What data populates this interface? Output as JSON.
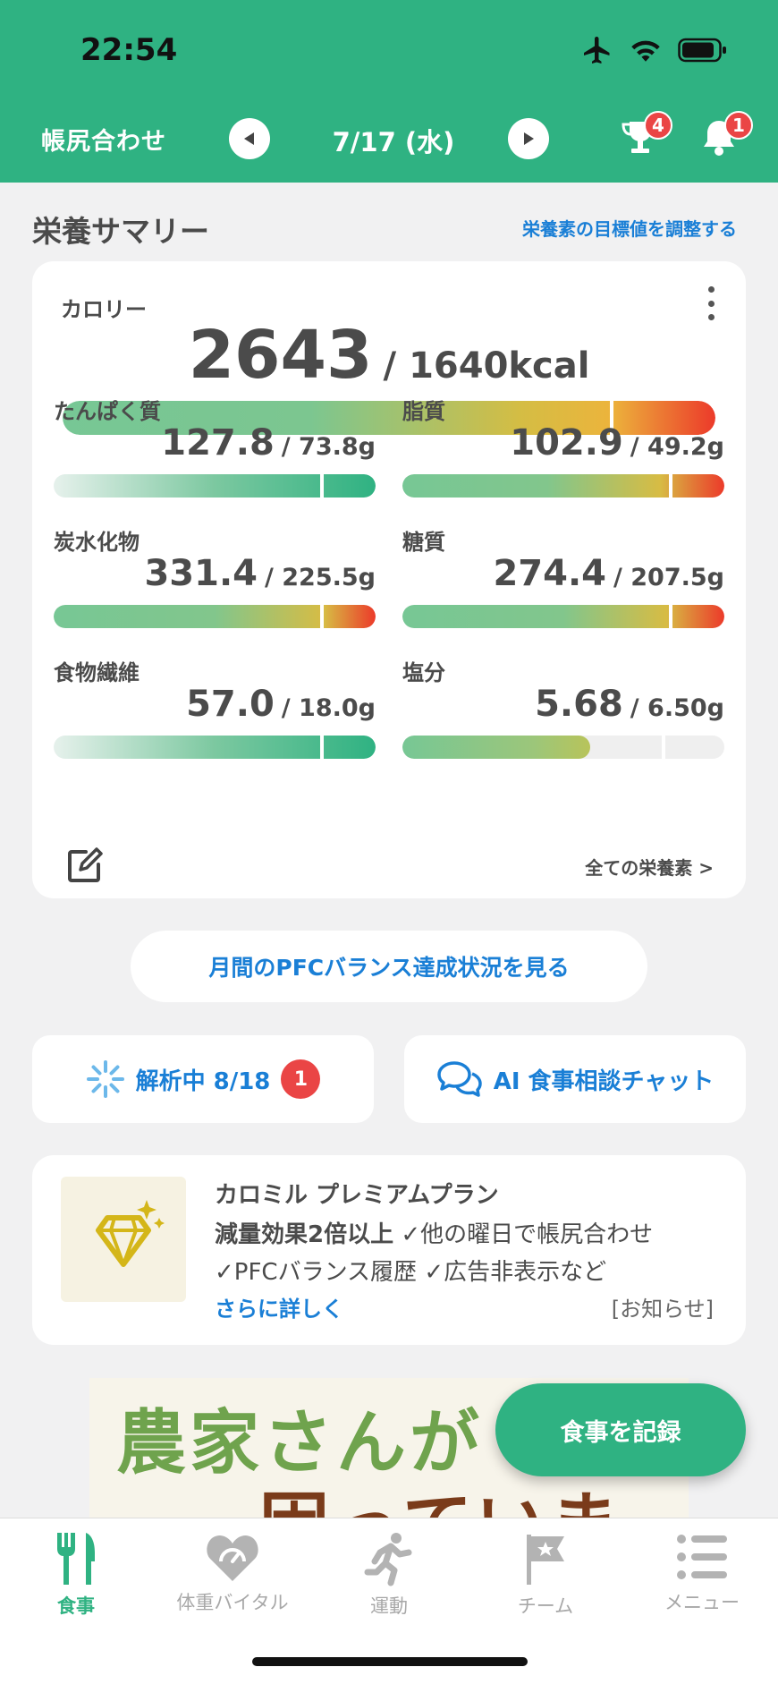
{
  "status_bar": {
    "time": "22:54"
  },
  "header": {
    "title": "帳尻合わせ",
    "date": "7/17 (水)",
    "trophy_badge": "4",
    "bell_badge": "1",
    "background": "#2fb282"
  },
  "summary": {
    "title": "栄養サマリー",
    "adjust_link": "栄養素の目標値を調整する",
    "calorie": {
      "label": "カロリー",
      "value": "2643",
      "target": "/ 1640kcal",
      "progress": 1.61
    },
    "nutrients": [
      {
        "label": "たんぱく質",
        "value": "127.8",
        "target": "/ 73.8g",
        "status": "over-good"
      },
      {
        "label": "脂質",
        "value": "102.9",
        "target": "/ 49.2g",
        "status": "over"
      },
      {
        "label": "炭水化物",
        "value": "331.4",
        "target": "/ 225.5g",
        "status": "over"
      },
      {
        "label": "糖質",
        "value": "274.4",
        "target": "/ 207.5g",
        "status": "over"
      },
      {
        "label": "食物繊維",
        "value": "57.0",
        "target": "/ 18.0g",
        "status": "over-good"
      },
      {
        "label": "塩分",
        "value": "5.68",
        "target": "/ 6.50g",
        "status": "under",
        "progress": 0.87
      }
    ],
    "all_nutrients_link": "全ての栄養素 >"
  },
  "pfc_button": "月間のPFCバランス達成状況を見る",
  "analysis": {
    "label": "解析中 8/18",
    "badge": "1"
  },
  "ai_chat": {
    "label": "AI 食事相談チャット"
  },
  "premium": {
    "title": "カロミル プレミアムプラン",
    "line1_bold": "減量効果2倍以上",
    "line1_rest": " ✓他の曜日で帳尻合わせ",
    "line2": "✓PFCバランス履歴 ✓広告非表示など",
    "more": "さらに詳しく",
    "notice": "[お知らせ]"
  },
  "ad": {
    "line1": "農家さんが",
    "line2": "困っています"
  },
  "record_button": "食事を記録",
  "tabs": [
    {
      "label": "食事",
      "icon": "fork-knife-icon",
      "active": true
    },
    {
      "label": "体重バイタル",
      "icon": "heart-scale-icon",
      "active": false
    },
    {
      "label": "運動",
      "icon": "runner-icon",
      "active": false
    },
    {
      "label": "チーム",
      "icon": "flag-icon",
      "active": false
    },
    {
      "label": "メニュー",
      "icon": "menu-list-icon",
      "active": false
    }
  ],
  "colors": {
    "accent": "#2fb282",
    "link": "#1a7fd6",
    "badge": "#ea4545"
  }
}
